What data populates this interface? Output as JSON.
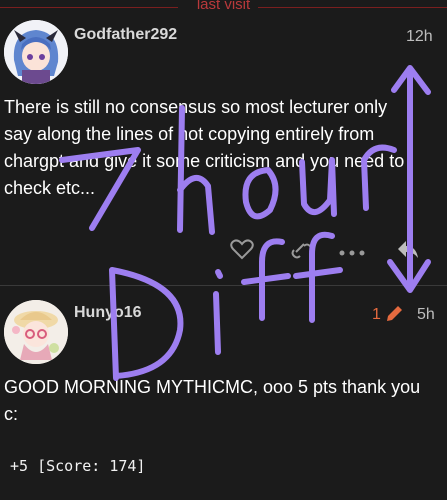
{
  "last_visit": "last visit",
  "posts": [
    {
      "username": "Godfather292",
      "time": "12h",
      "lines": [
        "There is still no consensus so most lecturer only",
        "say along the lines of not copying entirely from",
        "chargpt and give it some criticism and you need to",
        "check etc..."
      ]
    },
    {
      "username": "Hunyo16",
      "time": "5h",
      "edit_count": "1",
      "lines": [
        "GOOD MORNING MYTHICMC, ooo 5 pts thank you",
        "c:"
      ],
      "code": "+5 [Score: 174]"
    }
  ],
  "annotation": {
    "line1": "7 hour",
    "line2": "Diff",
    "color": "#9d7ef0"
  },
  "colors": {
    "background": "#1b1b1b",
    "accent_red": "#b9393b",
    "edit_orange": "#e56a3f"
  },
  "icons": [
    "like-icon",
    "more-icon",
    "reply-icon",
    "pencil-icon"
  ]
}
